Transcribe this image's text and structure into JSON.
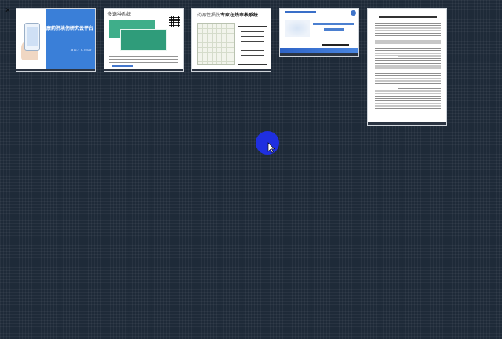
{
  "close_glyph": "×",
  "slides": [
    {
      "id": "s1",
      "title": "中康药肝境伤研究云平台",
      "brand": "MILI Cloud"
    },
    {
      "id": "s2",
      "title": "多选种系统"
    },
    {
      "id": "s3",
      "title_prefix": "药源性损伤",
      "title_strong": "专家在线审核系统"
    },
    {
      "id": "s4",
      "title": ""
    },
    {
      "id": "s5",
      "title": ""
    }
  ],
  "colors": {
    "background": "#1e2a38",
    "cursor": "#1f2fe0",
    "accent": "#3a7fd8"
  },
  "icons": [
    "close-icon",
    "mouse-pointer-icon"
  ]
}
